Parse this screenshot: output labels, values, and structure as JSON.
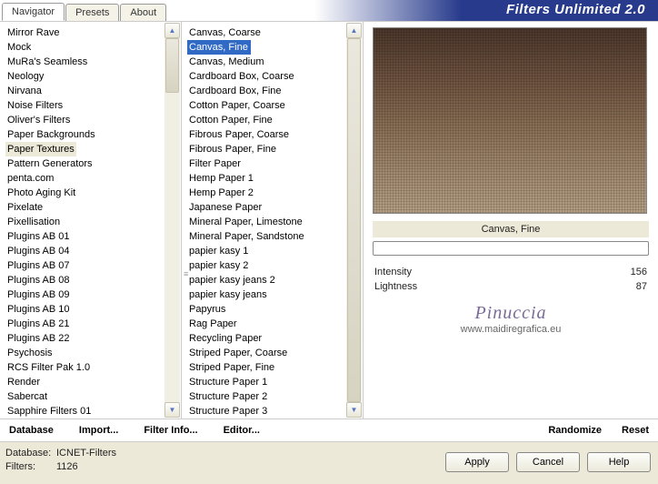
{
  "app_title": "Filters Unlimited 2.0",
  "tabs": {
    "navigator": "Navigator",
    "presets": "Presets",
    "about": "About"
  },
  "categories": [
    "Mirror Rave",
    "Mock",
    "MuRa's Seamless",
    "Neology",
    "Nirvana",
    "Noise Filters",
    "Oliver's Filters",
    "Paper Backgrounds",
    "Paper Textures",
    "Pattern Generators",
    "penta.com",
    "Photo Aging Kit",
    "Pixelate",
    "Pixellisation",
    "Plugins AB 01",
    "Plugins AB 04",
    "Plugins AB 07",
    "Plugins AB 08",
    "Plugins AB 09",
    "Plugins AB 10",
    "Plugins AB 21",
    "Plugins AB 22",
    "Psychosis",
    "RCS Filter Pak 1.0",
    "Render",
    "Sabercat",
    "Sapphire Filters 01"
  ],
  "filters": [
    "Canvas, Coarse",
    "Canvas, Fine",
    "Canvas, Medium",
    "Cardboard Box, Coarse",
    "Cardboard Box, Fine",
    "Cotton Paper, Coarse",
    "Cotton Paper, Fine",
    "Fibrous Paper, Coarse",
    "Fibrous Paper, Fine",
    "Filter Paper",
    "Hemp Paper 1",
    "Hemp Paper 2",
    "Japanese Paper",
    "Mineral Paper, Limestone",
    "Mineral Paper, Sandstone",
    "papier kasy 1",
    "papier kasy 2",
    "papier kasy jeans 2",
    "papier kasy jeans",
    "Papyrus",
    "Rag Paper",
    "Recycling Paper",
    "Striped Paper, Coarse",
    "Striped Paper, Fine",
    "Structure Paper 1",
    "Structure Paper 2",
    "Structure Paper 3"
  ],
  "selected_filter_label": "Canvas, Fine",
  "params": {
    "intensity": {
      "label": "Intensity",
      "value": "156"
    },
    "lightness": {
      "label": "Lightness",
      "value": "87"
    }
  },
  "watermark": {
    "name": "Pinuccia",
    "url": "www.maidiregrafica.eu"
  },
  "toolbar": {
    "database": "Database",
    "import": "Import...",
    "filter_info": "Filter Info...",
    "editor": "Editor...",
    "randomize": "Randomize",
    "reset": "Reset"
  },
  "footer": {
    "db_label": "Database:",
    "db_value": "ICNET-Filters",
    "filters_label": "Filters:",
    "filters_value": "1126",
    "apply": "Apply",
    "cancel": "Cancel",
    "help": "Help"
  }
}
